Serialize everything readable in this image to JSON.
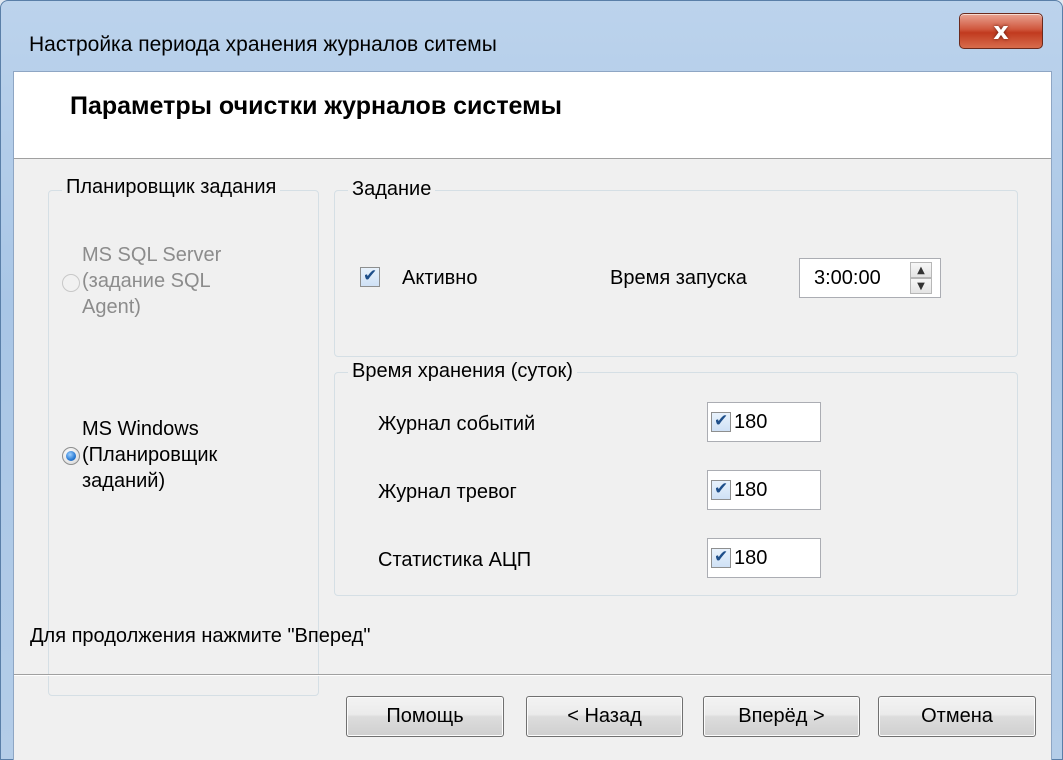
{
  "window": {
    "title": "Настройка периода хранения журналов ситемы",
    "close_label": "x"
  },
  "header": {
    "title": "Параметры очистки журналов системы"
  },
  "scheduler": {
    "group_label": "Планировщик задания",
    "options": [
      {
        "label_lines": [
          "MS SQL Server",
          "(задание SQL",
          "Agent)"
        ],
        "selected": false,
        "enabled": false
      },
      {
        "label_lines": [
          "MS Windows",
          "(Планировщик",
          "заданий)"
        ],
        "selected": true,
        "enabled": true
      }
    ]
  },
  "task": {
    "group_label": "Задание",
    "active_label": "Активно",
    "active_checked": true,
    "start_time_label": "Время запуска",
    "start_time_value": "3:00:00"
  },
  "retention": {
    "group_label": "Время хранения (суток)",
    "rows": [
      {
        "label": "Журнал событий",
        "checked": true,
        "value": "180"
      },
      {
        "label": "Журнал тревог",
        "checked": true,
        "value": "180"
      },
      {
        "label": "Статистика АЦП",
        "checked": true,
        "value": "180"
      }
    ]
  },
  "status": "Для продолжения нажмите \"Вперед\"",
  "buttons": {
    "help": "Помощь",
    "back": "< Назад",
    "next": "Вперёд >",
    "cancel": "Отмена"
  }
}
